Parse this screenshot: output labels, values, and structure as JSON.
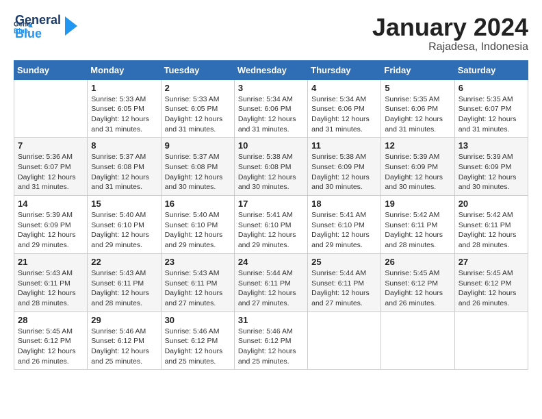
{
  "header": {
    "logo_line1": "General",
    "logo_line2": "Blue",
    "month": "January 2024",
    "location": "Rajadesa, Indonesia"
  },
  "days_of_week": [
    "Sunday",
    "Monday",
    "Tuesday",
    "Wednesday",
    "Thursday",
    "Friday",
    "Saturday"
  ],
  "weeks": [
    [
      {
        "num": "",
        "info": ""
      },
      {
        "num": "1",
        "info": "Sunrise: 5:33 AM\nSunset: 6:05 PM\nDaylight: 12 hours\nand 31 minutes."
      },
      {
        "num": "2",
        "info": "Sunrise: 5:33 AM\nSunset: 6:05 PM\nDaylight: 12 hours\nand 31 minutes."
      },
      {
        "num": "3",
        "info": "Sunrise: 5:34 AM\nSunset: 6:06 PM\nDaylight: 12 hours\nand 31 minutes."
      },
      {
        "num": "4",
        "info": "Sunrise: 5:34 AM\nSunset: 6:06 PM\nDaylight: 12 hours\nand 31 minutes."
      },
      {
        "num": "5",
        "info": "Sunrise: 5:35 AM\nSunset: 6:06 PM\nDaylight: 12 hours\nand 31 minutes."
      },
      {
        "num": "6",
        "info": "Sunrise: 5:35 AM\nSunset: 6:07 PM\nDaylight: 12 hours\nand 31 minutes."
      }
    ],
    [
      {
        "num": "7",
        "info": "Sunrise: 5:36 AM\nSunset: 6:07 PM\nDaylight: 12 hours\nand 31 minutes."
      },
      {
        "num": "8",
        "info": "Sunrise: 5:37 AM\nSunset: 6:08 PM\nDaylight: 12 hours\nand 31 minutes."
      },
      {
        "num": "9",
        "info": "Sunrise: 5:37 AM\nSunset: 6:08 PM\nDaylight: 12 hours\nand 30 minutes."
      },
      {
        "num": "10",
        "info": "Sunrise: 5:38 AM\nSunset: 6:08 PM\nDaylight: 12 hours\nand 30 minutes."
      },
      {
        "num": "11",
        "info": "Sunrise: 5:38 AM\nSunset: 6:09 PM\nDaylight: 12 hours\nand 30 minutes."
      },
      {
        "num": "12",
        "info": "Sunrise: 5:39 AM\nSunset: 6:09 PM\nDaylight: 12 hours\nand 30 minutes."
      },
      {
        "num": "13",
        "info": "Sunrise: 5:39 AM\nSunset: 6:09 PM\nDaylight: 12 hours\nand 30 minutes."
      }
    ],
    [
      {
        "num": "14",
        "info": "Sunrise: 5:39 AM\nSunset: 6:09 PM\nDaylight: 12 hours\nand 29 minutes."
      },
      {
        "num": "15",
        "info": "Sunrise: 5:40 AM\nSunset: 6:10 PM\nDaylight: 12 hours\nand 29 minutes."
      },
      {
        "num": "16",
        "info": "Sunrise: 5:40 AM\nSunset: 6:10 PM\nDaylight: 12 hours\nand 29 minutes."
      },
      {
        "num": "17",
        "info": "Sunrise: 5:41 AM\nSunset: 6:10 PM\nDaylight: 12 hours\nand 29 minutes."
      },
      {
        "num": "18",
        "info": "Sunrise: 5:41 AM\nSunset: 6:10 PM\nDaylight: 12 hours\nand 29 minutes."
      },
      {
        "num": "19",
        "info": "Sunrise: 5:42 AM\nSunset: 6:11 PM\nDaylight: 12 hours\nand 28 minutes."
      },
      {
        "num": "20",
        "info": "Sunrise: 5:42 AM\nSunset: 6:11 PM\nDaylight: 12 hours\nand 28 minutes."
      }
    ],
    [
      {
        "num": "21",
        "info": "Sunrise: 5:43 AM\nSunset: 6:11 PM\nDaylight: 12 hours\nand 28 minutes."
      },
      {
        "num": "22",
        "info": "Sunrise: 5:43 AM\nSunset: 6:11 PM\nDaylight: 12 hours\nand 28 minutes."
      },
      {
        "num": "23",
        "info": "Sunrise: 5:43 AM\nSunset: 6:11 PM\nDaylight: 12 hours\nand 27 minutes."
      },
      {
        "num": "24",
        "info": "Sunrise: 5:44 AM\nSunset: 6:11 PM\nDaylight: 12 hours\nand 27 minutes."
      },
      {
        "num": "25",
        "info": "Sunrise: 5:44 AM\nSunset: 6:11 PM\nDaylight: 12 hours\nand 27 minutes."
      },
      {
        "num": "26",
        "info": "Sunrise: 5:45 AM\nSunset: 6:12 PM\nDaylight: 12 hours\nand 26 minutes."
      },
      {
        "num": "27",
        "info": "Sunrise: 5:45 AM\nSunset: 6:12 PM\nDaylight: 12 hours\nand 26 minutes."
      }
    ],
    [
      {
        "num": "28",
        "info": "Sunrise: 5:45 AM\nSunset: 6:12 PM\nDaylight: 12 hours\nand 26 minutes."
      },
      {
        "num": "29",
        "info": "Sunrise: 5:46 AM\nSunset: 6:12 PM\nDaylight: 12 hours\nand 25 minutes."
      },
      {
        "num": "30",
        "info": "Sunrise: 5:46 AM\nSunset: 6:12 PM\nDaylight: 12 hours\nand 25 minutes."
      },
      {
        "num": "31",
        "info": "Sunrise: 5:46 AM\nSunset: 6:12 PM\nDaylight: 12 hours\nand 25 minutes."
      },
      {
        "num": "",
        "info": ""
      },
      {
        "num": "",
        "info": ""
      },
      {
        "num": "",
        "info": ""
      }
    ]
  ]
}
